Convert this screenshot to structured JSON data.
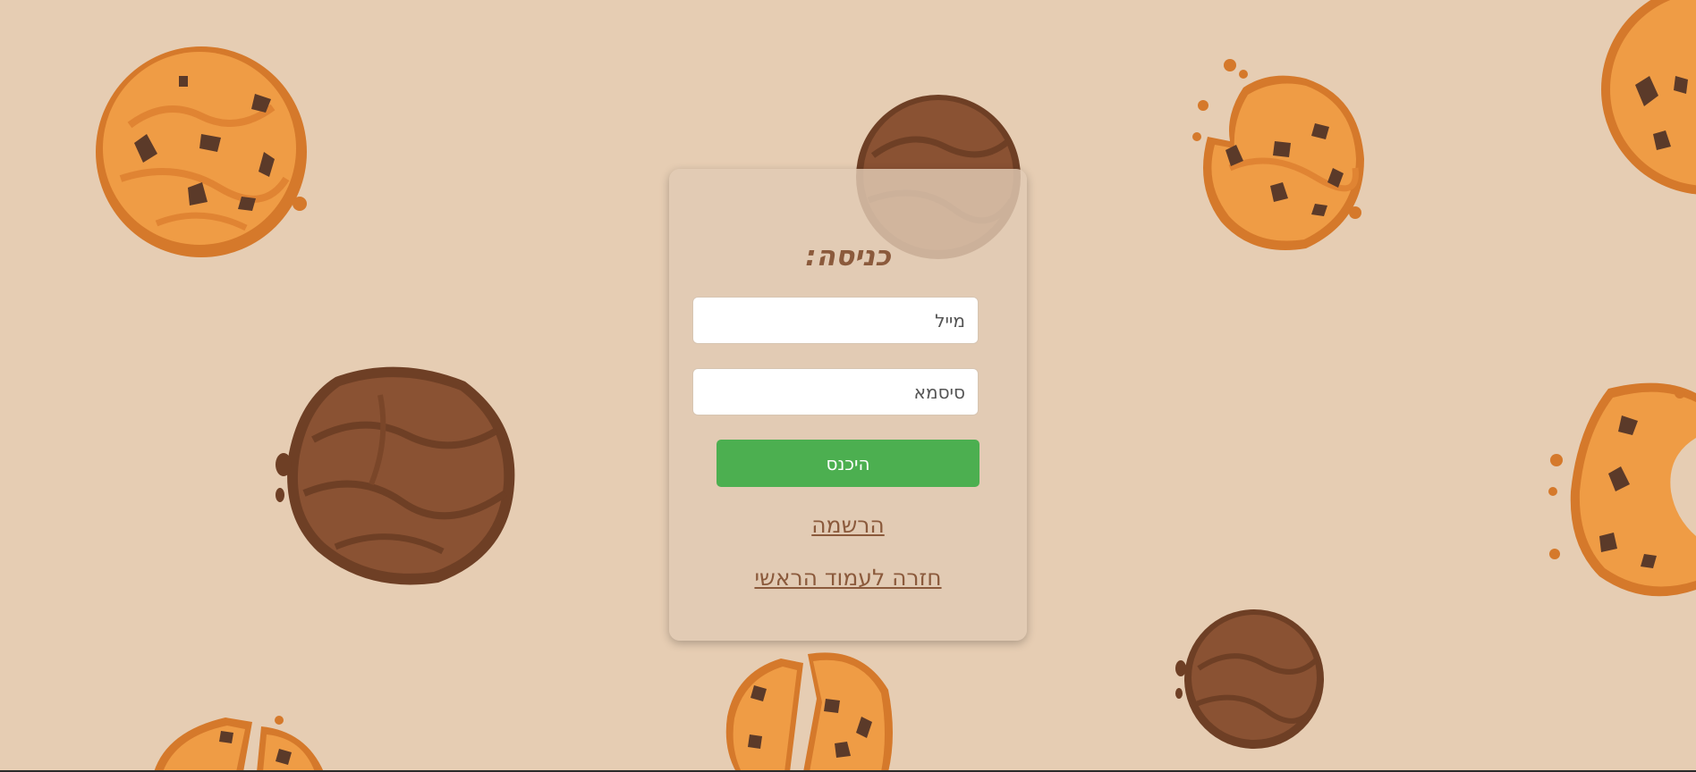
{
  "login": {
    "title": "כניסה:",
    "email": {
      "placeholder": "מייל",
      "value": ""
    },
    "password": {
      "placeholder": "סיסמא",
      "value": ""
    },
    "submit_label": "היכנס",
    "register_link": "הרשמה",
    "home_link": "חזרה לעמוד הראשי"
  },
  "colors": {
    "background": "#e6cdb3",
    "card": "#e1cbb4",
    "accent_brown": "#8b5a3c",
    "button_green": "#4caf50",
    "button_text": "#ffffff"
  },
  "decorations": {
    "background_icons": [
      "cookie-golden-icon",
      "cookie-chocolate-icon",
      "cookie-bitten-icon",
      "cookie-broken-icon"
    ]
  }
}
